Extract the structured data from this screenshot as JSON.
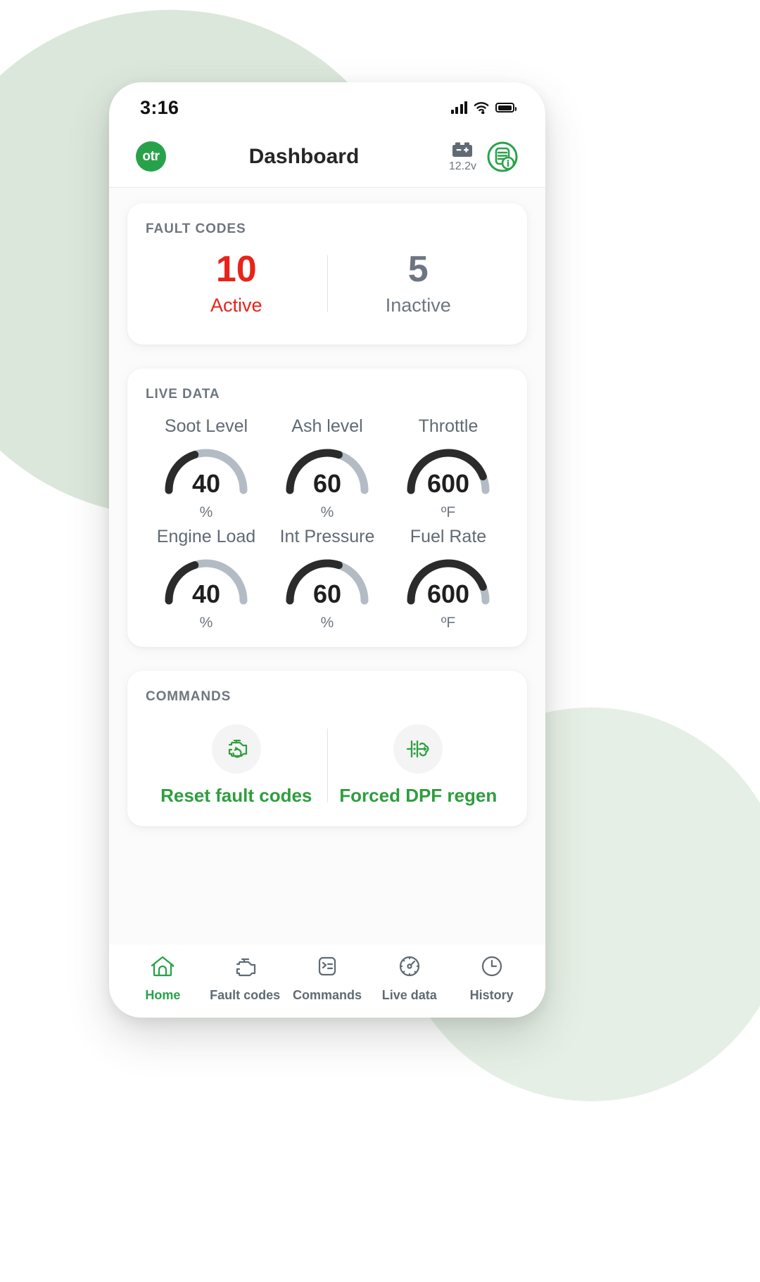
{
  "status_bar": {
    "time": "3:16",
    "icons": [
      "signal-icon",
      "wifi-icon",
      "battery-icon"
    ]
  },
  "header": {
    "logo_text": "otr",
    "title": "Dashboard",
    "battery_voltage": "12.2v",
    "battery_icon": "car-battery-icon",
    "dpf_icon": "dpf-status-icon"
  },
  "fault_codes": {
    "title": "FAULT CODES",
    "active": {
      "count": "10",
      "label": "Active",
      "color": "#E8231B"
    },
    "inactive": {
      "count": "5",
      "label": "Inactive",
      "color": "#6d7680"
    }
  },
  "live_data": {
    "title": "LIVE DATA",
    "gauges": [
      {
        "name": "Soot Level",
        "value": "40",
        "unit": "%",
        "percent": 40
      },
      {
        "name": "Ash level",
        "value": "60",
        "unit": "%",
        "percent": 60
      },
      {
        "name": "Throttle",
        "value": "600",
        "unit": "ºF",
        "percent": 88
      },
      {
        "name": "Engine Load",
        "value": "40",
        "unit": "%",
        "percent": 40
      },
      {
        "name": "Int Pressure",
        "value": "60",
        "unit": "%",
        "percent": 60
      },
      {
        "name": "Fuel Rate",
        "value": "600",
        "unit": "ºF",
        "percent": 88
      }
    ],
    "arc_fill_color": "#2b2b2b",
    "arc_track_color": "#b3bcc4"
  },
  "commands": {
    "title": "COMMANDS",
    "items": [
      {
        "label": "Reset fault codes",
        "icon": "engine-reset-icon"
      },
      {
        "label": "Forced DPF regen",
        "icon": "dpf-regen-icon"
      }
    ],
    "accent_color": "#2E9E3E"
  },
  "tabbar": {
    "items": [
      {
        "label": "Home",
        "icon": "home-icon",
        "active": true
      },
      {
        "label": "Fault codes",
        "icon": "engine-icon",
        "active": false
      },
      {
        "label": "Commands",
        "icon": "terminal-icon",
        "active": false
      },
      {
        "label": "Live data",
        "icon": "speedometer-icon",
        "active": false
      },
      {
        "label": "History",
        "icon": "clock-icon",
        "active": false
      }
    ],
    "active_color": "#28A24A",
    "inactive_color": "#5f6a74"
  }
}
